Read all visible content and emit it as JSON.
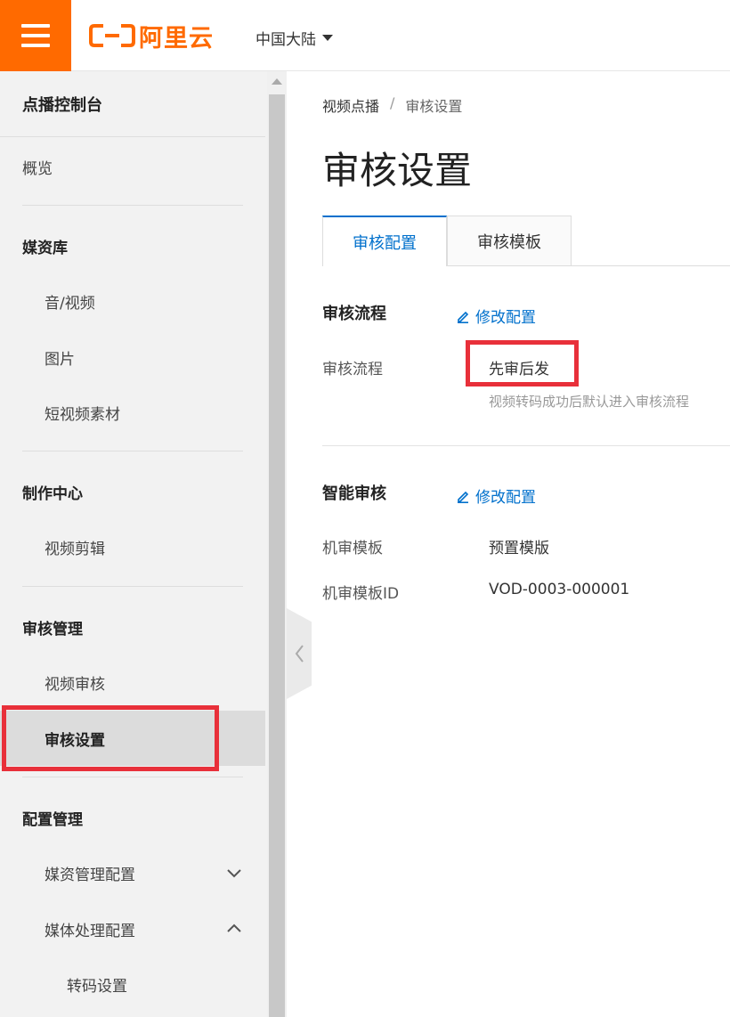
{
  "header": {
    "brand": "阿里云",
    "region": "中国大陆"
  },
  "sidebar": {
    "title": "点播控制台",
    "overview": "概览",
    "media_library": {
      "label": "媒资库",
      "items": [
        "音/视频",
        "图片",
        "短视频素材"
      ]
    },
    "production": {
      "label": "制作中心",
      "items": [
        "视频剪辑"
      ]
    },
    "review_mgmt": {
      "label": "审核管理",
      "items": [
        "视频审核",
        "审核设置"
      ]
    },
    "config_mgmt": {
      "label": "配置管理",
      "items": [
        "媒资管理配置",
        "媒体处理配置"
      ],
      "subitems": [
        "转码设置"
      ]
    }
  },
  "main": {
    "breadcrumb": [
      "视频点播",
      "审核设置"
    ],
    "breadcrumb_sep": "/",
    "title": "审核设置",
    "tabs": [
      "审核配置",
      "审核模板"
    ],
    "review_flow": {
      "title": "审核流程",
      "edit": "修改配置",
      "label": "审核流程",
      "value": "先审后发",
      "hint": "视频转码成功后默认进入审核流程"
    },
    "smart_review": {
      "title": "智能审核",
      "edit": "修改配置",
      "template_label": "机审模板",
      "template_value": "预置模版",
      "template_id_label": "机审模板ID",
      "template_id_value": "VOD-0003-000001"
    }
  },
  "colors": {
    "brand_orange": "#ff6a00",
    "link_blue": "#0070cc",
    "highlight_red": "#e8303a"
  }
}
